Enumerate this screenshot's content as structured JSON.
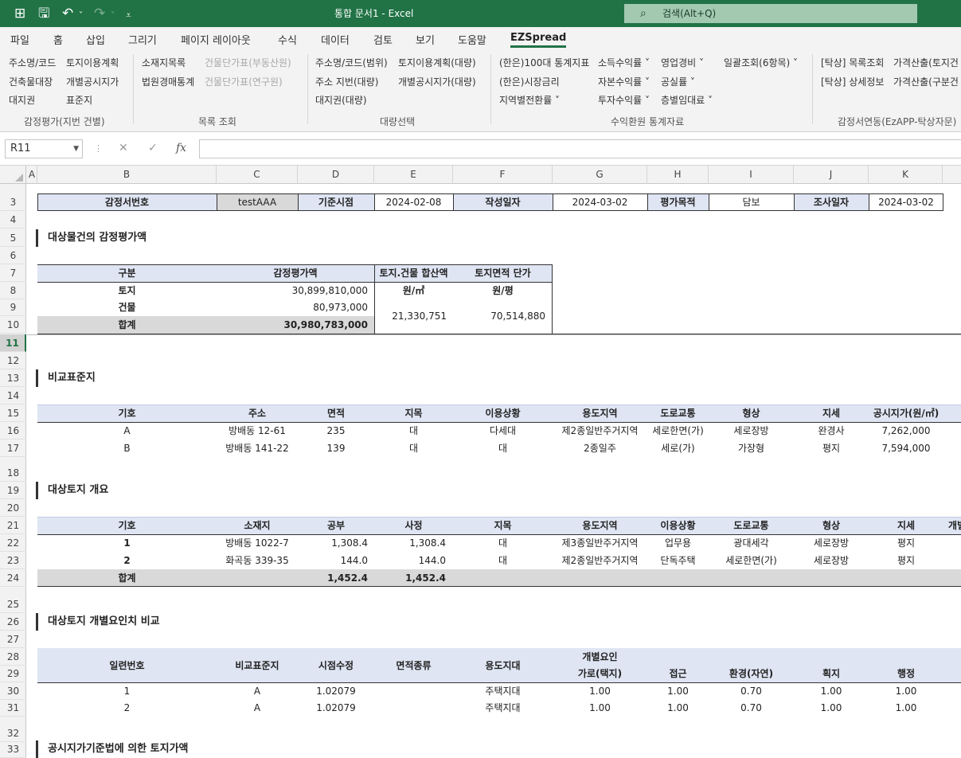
{
  "app": {
    "title": "통합 문서1  -  Excel",
    "search_placeholder": "검색(Alt+Q)"
  },
  "tabs": [
    "파일",
    "홈",
    "삽입",
    "그리기",
    "페이지 레이아웃",
    "수식",
    "데이터",
    "검토",
    "보기",
    "도움말",
    "EZSpread"
  ],
  "ribbon": {
    "g1": {
      "items": [
        "주소명/코드",
        "토지이용계획",
        "건축물대장",
        "개별공시지가",
        "대지권",
        "표준지"
      ],
      "label": "감정평가(지번 건별)"
    },
    "g2": {
      "items": [
        "소재지목록",
        "건물단가표(부동산원)",
        "법원경매통계",
        "건물단가표(연구원)"
      ],
      "label": "목록 조회"
    },
    "g3": {
      "items": [
        "주소명/코드(범위)",
        "토지이용계획(대량)",
        "주소 지번(대량)",
        "개별공시지가(대량)",
        "대지권(대량)"
      ],
      "label": "대량선택"
    },
    "g4": {
      "items": [
        "(한은)100대 통계지표",
        "소득수익률 ˅",
        "영업경비 ˅",
        "일괄조회(6항목) ˅",
        "(한은)시장금리",
        "자본수익률 ˅",
        "공실률 ˅",
        "지역별전환률 ˅",
        "투자수익률 ˅",
        "층별임대료 ˅"
      ],
      "label": "수익환원 통계자료"
    },
    "g5": {
      "items": [
        "[탁상] 목록조회",
        "가격산출(토지건",
        "[탁상] 상세정보",
        "가격산출(구분건"
      ],
      "label": "감정서연동(EzAPP-탁상자문)"
    }
  },
  "formula_bar": {
    "name_box": "R11",
    "formula": ""
  },
  "columns": [
    "A",
    "B",
    "C",
    "D",
    "E",
    "F",
    "G",
    "H",
    "I",
    "J",
    "K"
  ],
  "rows": [
    "3",
    "4",
    "5",
    "6",
    "7",
    "8",
    "9",
    "10",
    "11",
    "12",
    "13",
    "14",
    "15",
    "16",
    "17",
    "18",
    "19",
    "20",
    "21",
    "22",
    "23",
    "24",
    "25",
    "26",
    "27",
    "28",
    "29",
    "30",
    "31",
    "32",
    "33"
  ],
  "selected_row": "11",
  "header_row": {
    "label1": "감정서번호",
    "value1": "testAAA",
    "label2": "기준시점",
    "value2": "2024-02-08",
    "label3": "작성일자",
    "value3": "2024-03-02",
    "label4": "평가목적",
    "value4": "담보",
    "label5": "조사일자",
    "value5": "2024-03-02"
  },
  "section1": {
    "title": "대상물건의 감정평가액",
    "headers": [
      "구분",
      "감정평가액",
      "토지.건물 합산액",
      "토지면적 단가"
    ],
    "units": [
      "원/㎡",
      "원/평"
    ],
    "rows": [
      [
        "토지",
        "30,899,810,000"
      ],
      [
        "건물",
        "80,973,000"
      ],
      [
        "합계",
        "30,980,783,000"
      ]
    ],
    "unit_values": [
      "21,330,751",
      "70,514,880"
    ]
  },
  "section2": {
    "title": "비교표준지",
    "headers": [
      "기호",
      "주소",
      "면적",
      "지목",
      "이용상황",
      "용도지역",
      "도로교통",
      "형상",
      "지세",
      "공시지가(원/㎡)"
    ],
    "rows": [
      [
        "A",
        "방배동 12-61",
        "235",
        "대",
        "다세대",
        "제2종일반주거지역",
        "세로한면(가)",
        "세로장방",
        "완경사",
        "7,262,000"
      ],
      [
        "B",
        "방배동 141-22",
        "139",
        "대",
        "대",
        "2종일주",
        "세로(가)",
        "가장형",
        "평지",
        "7,594,000"
      ]
    ]
  },
  "section3": {
    "title": "대상토지 개요",
    "headers": [
      "기호",
      "소재지",
      "공부",
      "사정",
      "지목",
      "용도지역",
      "이용상황",
      "도로교통",
      "형상",
      "지세",
      "개별"
    ],
    "rows": [
      [
        "1",
        "방배동 1022-7",
        "1,308.4",
        "1,308.4",
        "대",
        "제3종일반주거지역",
        "업무용",
        "광대세각",
        "세로장방",
        "평지"
      ],
      [
        "2",
        "화곡동 339-35",
        "144.0",
        "144.0",
        "대",
        "제2종일반주거지역",
        "단독주택",
        "세로한면(가)",
        "세로장방",
        "평지"
      ]
    ],
    "total": [
      "합계",
      "1,452.4",
      "1,452.4"
    ]
  },
  "section4": {
    "title": "대상토지 개별요인치 비교",
    "headers": [
      "일련번호",
      "비교표준지",
      "시점수정",
      "면적종류",
      "용도지대",
      "개별요인",
      "가로(택지)",
      "접근",
      "환경(자연)",
      "획지",
      "행정"
    ],
    "rows": [
      [
        "1",
        "A",
        "1.02079",
        "",
        "주택지대",
        "1.00",
        "1.00",
        "0.70",
        "1.00",
        "1.00"
      ],
      [
        "2",
        "A",
        "1.02079",
        "",
        "주택지대",
        "1.00",
        "1.00",
        "0.70",
        "1.00",
        "1.00"
      ]
    ]
  },
  "section5": {
    "title": "공시지가기준법에 의한 토지가액"
  }
}
